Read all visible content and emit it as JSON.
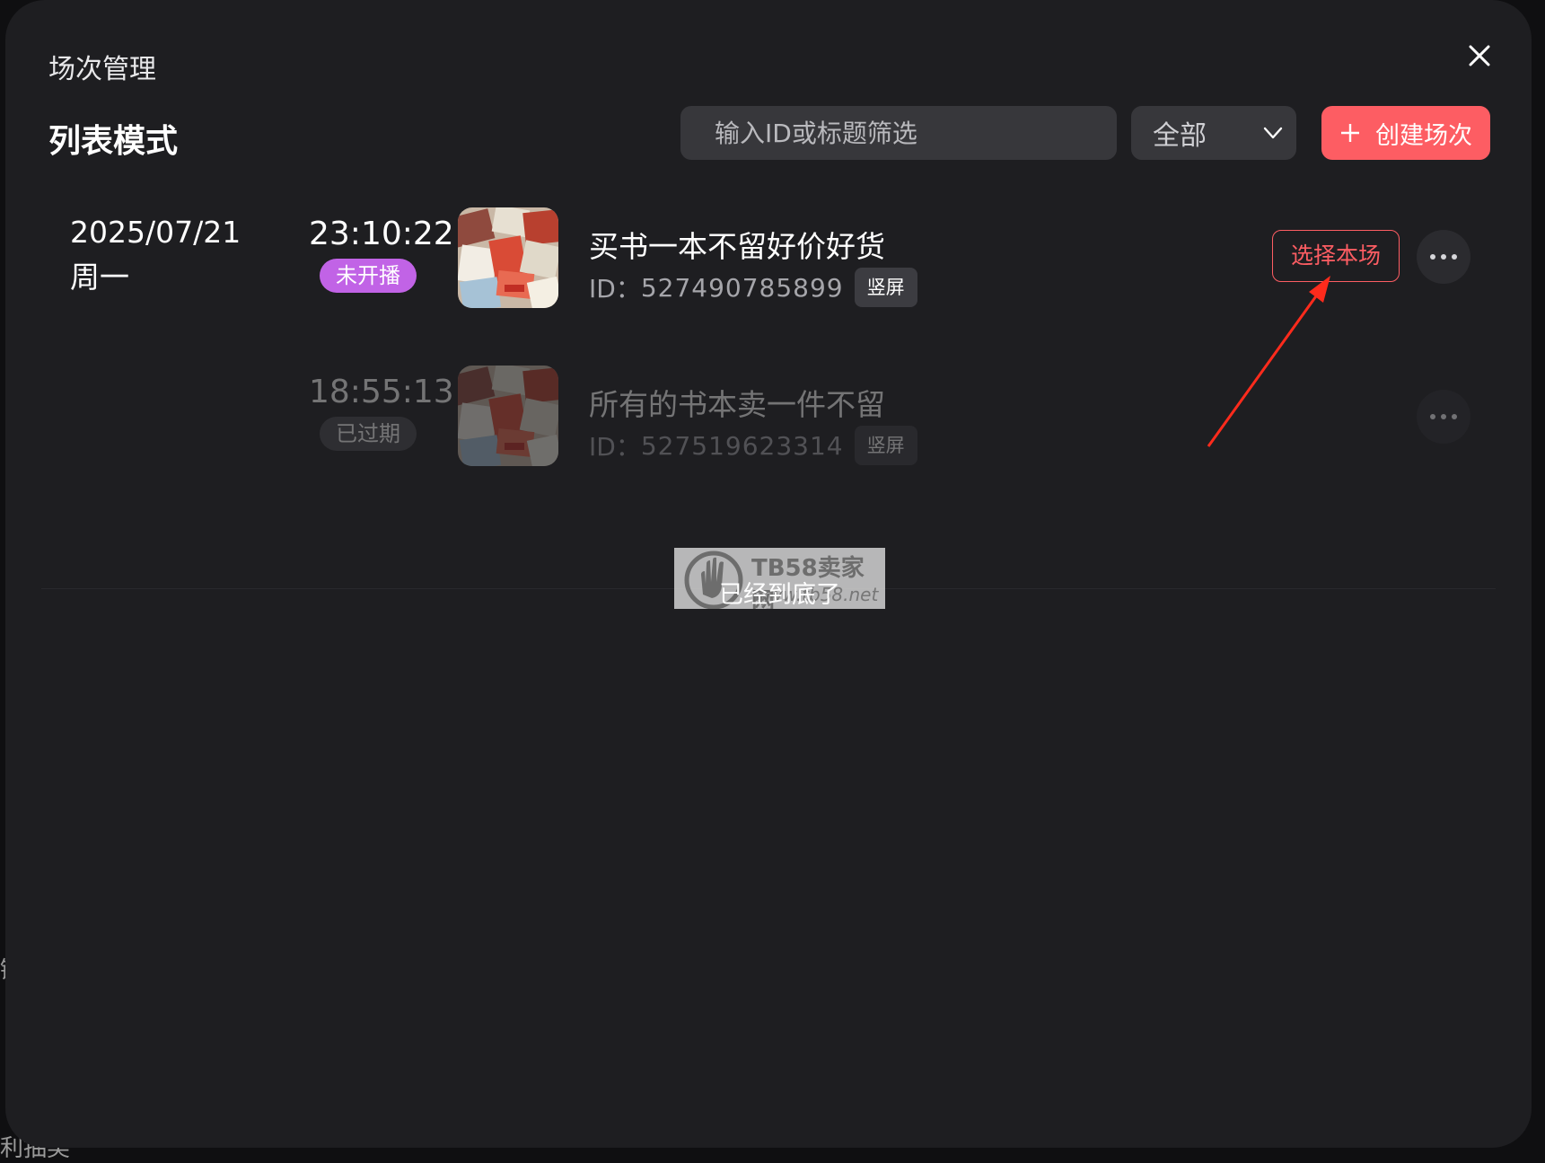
{
  "background_leak": {
    "text_a": "键",
    "text_b": "利抽奖"
  },
  "dialog": {
    "title": "场次管理",
    "mode_title": "列表模式",
    "search_placeholder": "输入ID或标题筛选",
    "filter_value": "全部",
    "create_label": "创建场次"
  },
  "date_group": {
    "date": "2025/07/21",
    "weekday": "周一"
  },
  "sessions": [
    {
      "time": "23:10:22",
      "status": "未开播",
      "status_color": "#c163e6",
      "title": "买书一本不留好价好货",
      "id_label": "ID：",
      "id": "527490785899",
      "tag": "竖屏",
      "action": "选择本场"
    },
    {
      "time": "18:55:13",
      "status": "已过期",
      "status_color": "#3a3a3e",
      "title": "所有的书本卖一件不留",
      "id_label": "ID：",
      "id": "527519623314",
      "tag": "竖屏"
    }
  ],
  "end_text": "已经到底了",
  "watermark": {
    "brand": "TB58卖家网",
    "url": "www.tb58.net"
  },
  "colors": {
    "accent": "#fd5d63",
    "dialog_bg": "#1e1e21",
    "annotation_arrow": "#ff2b1c"
  },
  "icons": {
    "close": "close-icon",
    "dropdown": "chevron-down-icon",
    "create": "plus-icon",
    "more": "more-dots-icon"
  }
}
